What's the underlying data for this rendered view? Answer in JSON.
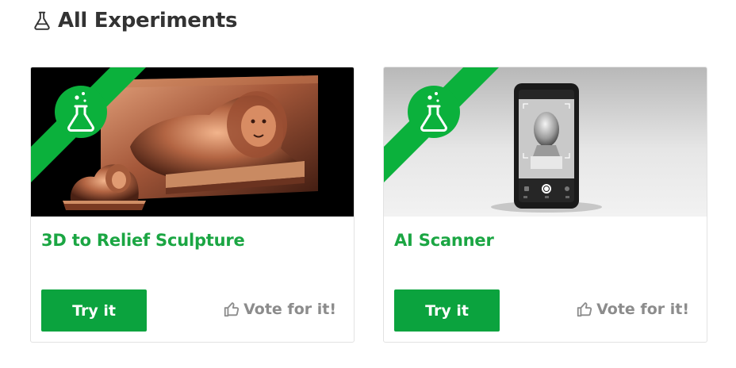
{
  "header": {
    "title": "All Experiments",
    "icon": "flask-icon"
  },
  "cards": [
    {
      "title": "3D to Relief Sculpture",
      "image": "copper lion relief sculpture",
      "badge_icon": "flask-icon",
      "try_label": "Try it",
      "vote_label": "Vote for it!",
      "vote_icon": "thumbs-up-icon"
    },
    {
      "title": "AI Scanner",
      "image": "smartphone scanning a bust",
      "badge_icon": "flask-icon",
      "try_label": "Try it",
      "vote_label": "Vote for it!",
      "vote_icon": "thumbs-up-icon"
    }
  ],
  "colors": {
    "accent_green": "#0ba33e",
    "title_green": "#1ba643",
    "ribbon_green": "#0bb13c",
    "vote_gray": "#8c8c8c",
    "heading": "#333333"
  }
}
